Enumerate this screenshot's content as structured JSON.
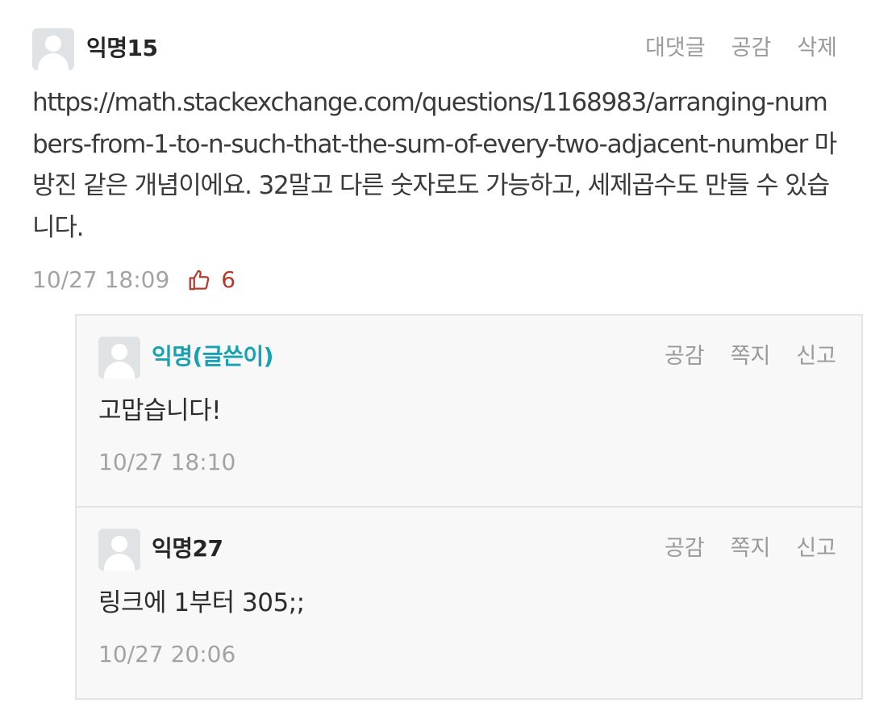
{
  "post": {
    "author": "익명15",
    "actions": [
      "대댓글",
      "공감",
      "삭제"
    ],
    "body": "https://math.stackexchange.com/questions/1168983/arranging-numbers-from-1-to-n-such-that-the-sum-of-every-two-adjacent-number 마방진 같은 개념이에요. 32말고 다른 숫자로도 가능하고, 세제곱수도 만들 수 있습니다.",
    "timestamp": "10/27 18:09",
    "like_icon": "thumbs-up-icon",
    "like_count": "6"
  },
  "replies": [
    {
      "author": "익명(글쓴이)",
      "is_author": true,
      "actions": [
        "공감",
        "쪽지",
        "신고"
      ],
      "text": "고맙습니다!",
      "timestamp": "10/27 18:10"
    },
    {
      "author": "익명27",
      "is_author": false,
      "actions": [
        "공감",
        "쪽지",
        "신고"
      ],
      "text": "링크에 1부터 305;;",
      "timestamp": "10/27 20:06"
    }
  ],
  "colors": {
    "author_accent": "#17a2b3",
    "like": "#b53a2c",
    "muted": "#9a9a9a",
    "reply_bg": "#f8f8f8"
  }
}
